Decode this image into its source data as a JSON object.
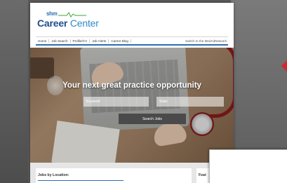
{
  "brand": {
    "shm": "shm",
    "career": "Career",
    "center": "Center"
  },
  "nav": {
    "items": [
      "Home",
      "Job Search",
      "Profile/CV",
      "Job Alerts",
      "Career Blog"
    ],
    "switch_link": "Switch to the MedAdNetwork"
  },
  "hero": {
    "title": "Your next great practice opportunity",
    "keyword_placeholder": "Keyword",
    "state_placeholder": "State",
    "search_label": "Search Jobs"
  },
  "sections": {
    "jobs_by_location": "Jobs by Location:",
    "featured": "Feat"
  },
  "colors": {
    "brand_blue": "#2a6fb0",
    "brand_dark_blue": "#1f4e8c",
    "pulse_green": "#3aa935",
    "accent_red": "#d8262c"
  }
}
